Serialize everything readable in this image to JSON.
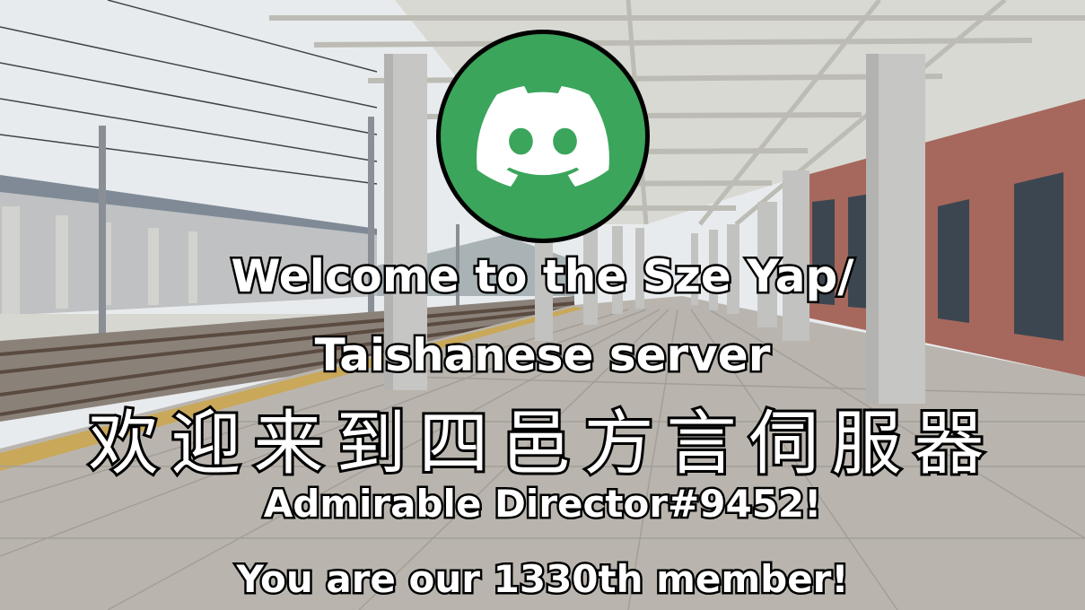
{
  "colors": {
    "avatar_bg": "#3ba55c",
    "avatar_border": "#000000",
    "text_fill": "#ffffff",
    "text_outline": "#000000",
    "sky": "#e9ecee",
    "platform": "#b8b4ac",
    "roof": "#dcdcd6",
    "pillar": "#c8c8c6",
    "brick": "#9a5a4e",
    "track": "#6d6258"
  },
  "avatar": {
    "icon": "discord-logo-icon"
  },
  "welcome": {
    "line1": "Welcome to the Sze Yap/",
    "line2": "Taishanese server",
    "chinese": "欢迎来到四邑方言伺服器"
  },
  "user": {
    "tag": "Admirable Director#9452!"
  },
  "member": {
    "message": "You are our 1330th member!"
  }
}
